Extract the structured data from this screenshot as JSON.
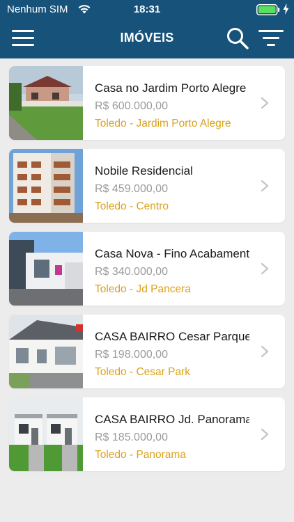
{
  "status_bar": {
    "carrier": "Nenhum SIM",
    "time": "18:31"
  },
  "header": {
    "title": "IMÓVEIS",
    "background": "#17527a"
  },
  "properties": [
    {
      "name": "Casa no Jardim Porto Alegre",
      "price": "R$ 600.000,00",
      "location": "Toledo - Jardim Porto Alegre",
      "photo": "house-photo"
    },
    {
      "name": "Nobile Residencial",
      "price": "R$ 459.000,00",
      "location": "Toledo - Centro",
      "photo": "building-photo"
    },
    {
      "name": "Casa Nova - Fino Acabamento",
      "price": "R$ 340.000,00",
      "location": "Toledo - Jd Pancera",
      "photo": "house-photo"
    },
    {
      "name": "CASA BAIRRO Cesar Parque",
      "price": "R$ 198.000,00",
      "location": "Toledo - Cesar Park",
      "photo": "house-photo"
    },
    {
      "name": "CASA BAIRRO Jd. Panorama",
      "price": "R$ 185.000,00",
      "location": "Toledo - Panorama",
      "photo": "house-render"
    }
  ],
  "colors": {
    "price": "#9b9b9b",
    "location": "#d9a21b",
    "background": "#ececec"
  },
  "icons": [
    "menu-icon",
    "search-icon",
    "filter-icon",
    "chevron-right-icon",
    "wifi-icon",
    "battery-icon",
    "charging-icon"
  ]
}
